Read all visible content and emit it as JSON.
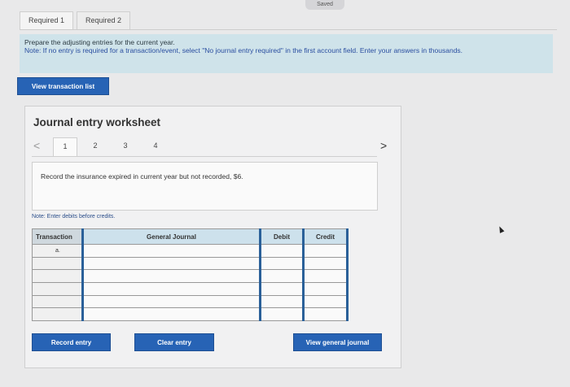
{
  "status": {
    "saved_label": "Saved"
  },
  "tabs": [
    {
      "label": "Required 1"
    },
    {
      "label": "Required 2"
    }
  ],
  "instructions": {
    "line1": "Prepare the adjusting entries for the current year.",
    "note": "Note: If no entry is required for a transaction/event, select \"No journal entry required\" in the first account field. Enter your answers in thousands."
  },
  "view_transaction_list_label": "View transaction list",
  "worksheet": {
    "title": "Journal entry worksheet",
    "pages": [
      "1",
      "2",
      "3",
      "4"
    ],
    "current_page": "1",
    "prev_arrow": "<",
    "next_arrow": ">",
    "transaction_text": "Record the insurance expired in current year but not recorded, $6.",
    "note": "Note: Enter debits before credits."
  },
  "journal_table": {
    "headers": [
      "Transaction",
      "General Journal",
      "Debit",
      "Credit"
    ],
    "rows": [
      {
        "transaction": "a.",
        "account": "",
        "debit": "",
        "credit": ""
      },
      {
        "transaction": "",
        "account": "",
        "debit": "",
        "credit": ""
      },
      {
        "transaction": "",
        "account": "",
        "debit": "",
        "credit": ""
      },
      {
        "transaction": "",
        "account": "",
        "debit": "",
        "credit": ""
      },
      {
        "transaction": "",
        "account": "",
        "debit": "",
        "credit": ""
      },
      {
        "transaction": "",
        "account": "",
        "debit": "",
        "credit": ""
      }
    ]
  },
  "buttons": {
    "record_entry": "Record entry",
    "clear_entry": "Clear entry",
    "view_general_journal": "View general journal"
  },
  "colors": {
    "primary_button": "#2763b5",
    "instructions_bg": "#cfe3ea",
    "table_header_bg": "#cde1ec"
  }
}
